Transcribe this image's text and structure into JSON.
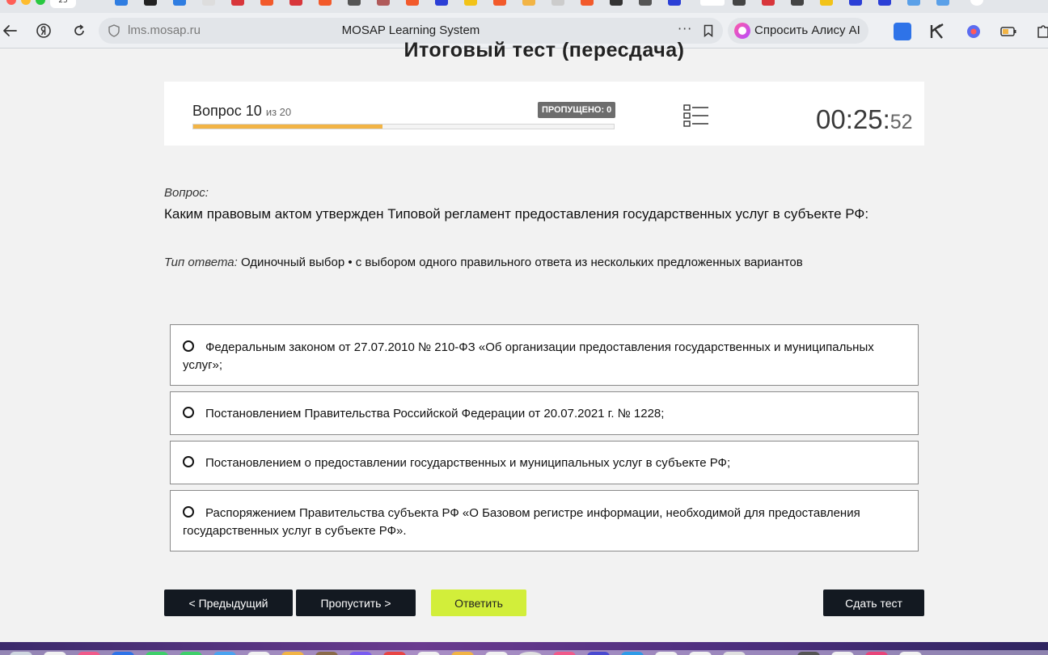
{
  "browser": {
    "active_tab_label": "25",
    "url_domain": "lms.mosap.ru",
    "page_title": "MOSAP Learning System",
    "assistant_button_label": "Спросить Алису AI",
    "more_label": "···"
  },
  "test": {
    "title": "Итоговый тест (пересдача)",
    "question_label": "Вопрос 10",
    "question_total_label": "из 20",
    "skipped_label": "ПРОПУЩЕНО: 0",
    "progress_fraction": 0.45,
    "timer_main": "00:25:",
    "timer_seconds": "52"
  },
  "question": {
    "label": "Вопрос:",
    "text": "Каким правовым актом утвержден Типовой регламент предоставления государственных услуг в субъекте РФ:",
    "answer_type_label": "Тип ответа:",
    "answer_type": "Одиночный выбор • с выбором одного правильного ответа из нескольких предложенных вариантов"
  },
  "options": [
    {
      "text": "Федеральным законом от 27.07.2010 № 210-ФЗ «Об организации предоставления государственных и муниципальных услуг»;"
    },
    {
      "text": "Постановлением Правительства Российской Федерации от 20.07.2021 г. № 1228;"
    },
    {
      "text": "Постановлением о предоставлении государственных и муниципальных услуг в субъекте РФ;"
    },
    {
      "text": "Распоряжением Правительства субъекта РФ «О Базовом регистре информации, необходимой для предоставления государственных услуг в субъекте РФ»."
    }
  ],
  "buttons": {
    "previous": "< Предыдущий",
    "skip": "Пропустить >",
    "answer": "Ответить",
    "submit": "Сдать тест"
  },
  "colors": {
    "progress": "#f2b445",
    "answer_button": "#d2ee3a",
    "dark_button": "#131921",
    "skipped_badge": "#6d6d6d"
  }
}
